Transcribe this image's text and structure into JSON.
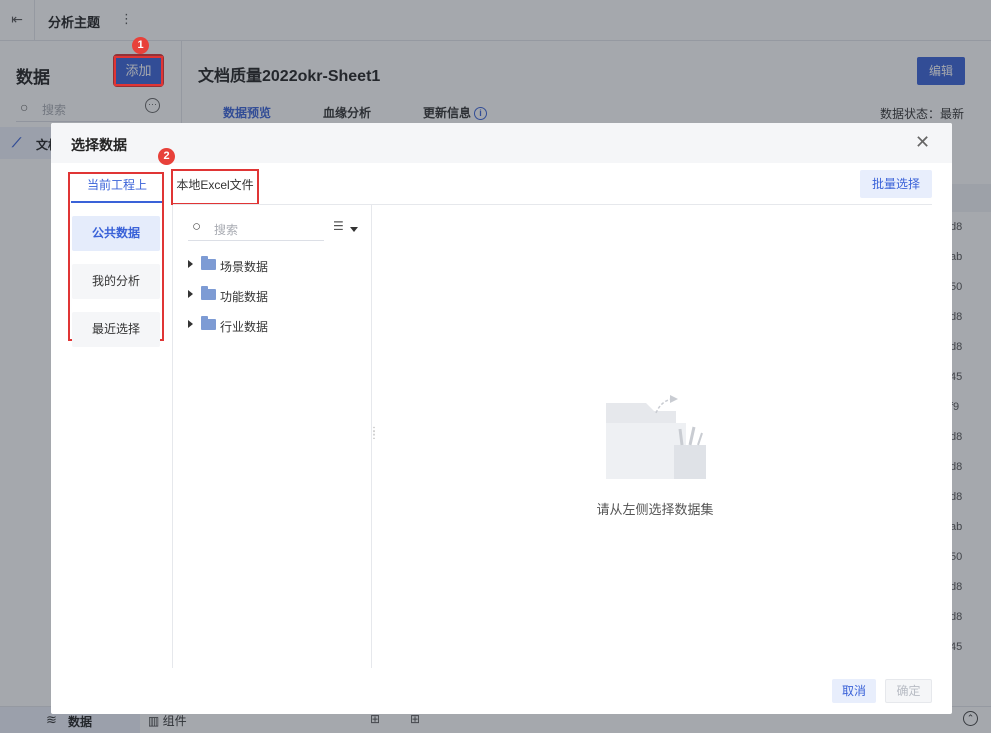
{
  "topbar": {
    "title": "分析主题",
    "back_icon": "exit-icon",
    "more_glyph": "⋮"
  },
  "left_panel": {
    "heading": "数据",
    "add_label": "添加",
    "search_placeholder": "搜索",
    "item_label": "文档"
  },
  "bottom_bar": {
    "data_label": "数据",
    "component_label": "组件"
  },
  "main": {
    "title": "文档质量2022okr-Sheet1",
    "edit_label": "编辑",
    "tabs": [
      "数据预览",
      "血缘分析",
      "更新信息"
    ],
    "status_label": "数据状态：",
    "status_value": "最新",
    "column_cells": [
      "d8",
      "ab",
      "50",
      "d8",
      "d8",
      "45",
      "f9",
      "d8",
      "d8",
      "d8",
      "ab",
      "50",
      "d8",
      "d8",
      "45"
    ]
  },
  "annotations": {
    "badge_1": "1",
    "badge_2": "2"
  },
  "modal": {
    "title": "选择数据",
    "source_tabs": [
      "当前工程上",
      "本地Excel文件"
    ],
    "batch_label": "批量选择",
    "categories": [
      "公共数据",
      "我的分析",
      "最近选择"
    ],
    "search_placeholder": "搜索",
    "tree_items": [
      "场景数据",
      "功能数据",
      "行业数据"
    ],
    "empty_text": "请从左侧选择数据集",
    "cancel_label": "取消",
    "ok_label": "确定"
  },
  "colors": {
    "accent": "#3a62d8",
    "highlight": "#e03535",
    "folder": "#7d9bd4"
  }
}
